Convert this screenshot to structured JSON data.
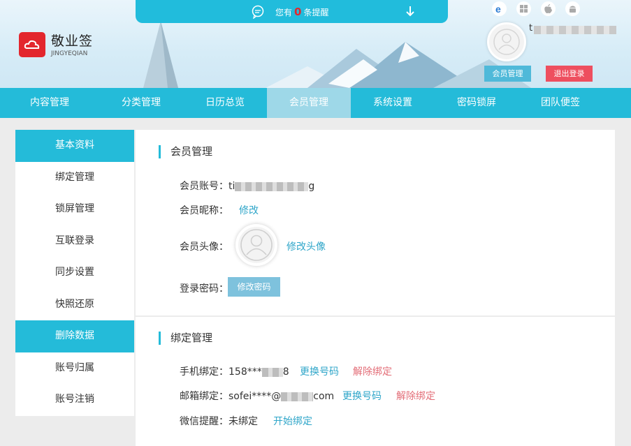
{
  "header": {
    "logo_cn": "敬业签",
    "logo_en": "JINGYEQIAN",
    "notice_prefix": "您有",
    "notice_count": "0",
    "notice_suffix": "条提醒",
    "user_initial": "t",
    "member_button": "会员管理",
    "logout_button": "退出登录"
  },
  "nav": {
    "items": [
      "内容管理",
      "分类管理",
      "日历总览",
      "会员管理",
      "系统设置",
      "密码锁屏",
      "团队便签"
    ]
  },
  "sidebar": {
    "items": [
      "基本资料",
      "绑定管理",
      "锁屏管理",
      "互联登录",
      "同步设置",
      "快照还原",
      "删除数据",
      "账号归属",
      "账号注销"
    ]
  },
  "member": {
    "title": "会员管理",
    "account_label": "会员账号：",
    "account_prefix": "ti",
    "account_suffix": "g",
    "nickname_label": "会员昵称：",
    "nickname_link": "修改",
    "avatar_label": "会员头像：",
    "avatar_link": "修改头像",
    "password_label": "登录密码：",
    "password_button": "修改密码"
  },
  "binding": {
    "title": "绑定管理",
    "phone_label": "手机绑定：",
    "phone_prefix": "158***",
    "phone_suffix": "8",
    "phone_change": "更换号码",
    "phone_unbind": "解除绑定",
    "email_label": "邮箱绑定：",
    "email_prefix": "sofei****@",
    "email_suffix": "com",
    "email_change": "更换号码",
    "email_unbind": "解除绑定",
    "wechat_label": "微信提醒：",
    "wechat_status": "未绑定",
    "wechat_link": "开始绑定"
  },
  "colors": {
    "accent": "#24bbd9",
    "danger": "#ee4f5f",
    "link": "#2fa6c9"
  }
}
